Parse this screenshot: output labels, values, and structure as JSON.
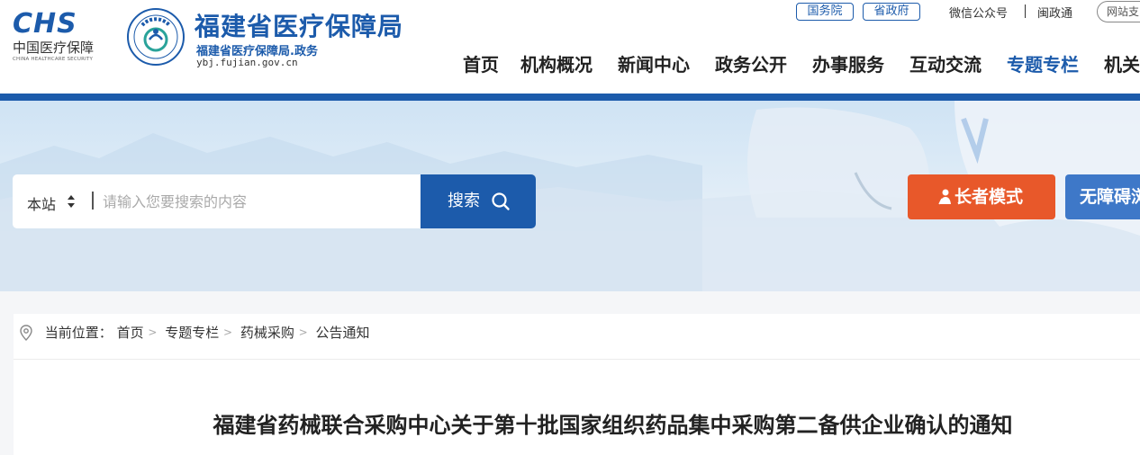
{
  "header": {
    "logo_mark": "CHS",
    "logo_cn": "中国医疗保障",
    "logo_en": "CHINA HEALTHCARE SECURITY",
    "emblem_text": "福建医疗保障",
    "site_title": "福建省医疗保障局",
    "site_subtitle": "福建省医疗保障局.政务",
    "site_domain": "ybj.fujian.gov.cn",
    "top_links": {
      "state_council": "国务院",
      "provincial_gov": "省政府",
      "wechat": "微信公众号",
      "minzhengtong": "闽政通",
      "site_support": "网站支"
    },
    "nav": [
      "首页",
      "机构概况",
      "新闻中心",
      "政务公开",
      "办事服务",
      "互动交流",
      "专题专栏",
      "机关"
    ],
    "nav_active_index": 6
  },
  "search": {
    "scope": "本站",
    "placeholder": "请输入您要搜索的内容",
    "button_label": "搜索"
  },
  "modes": {
    "elder_label": "长者模式",
    "accessible_label": "无障碍浏"
  },
  "breadcrumb": {
    "prefix": "当前位置：",
    "items": [
      "首页",
      "专题专栏",
      "药械采购",
      "公告通知"
    ]
  },
  "article": {
    "title": "福建省药械联合采购中心关于第十批国家组织药品集中采购第二备供企业确认的通知"
  },
  "colors": {
    "brand_blue": "#1c5bab",
    "elder_orange": "#e8582a",
    "accessible_blue": "#3e78c8"
  }
}
